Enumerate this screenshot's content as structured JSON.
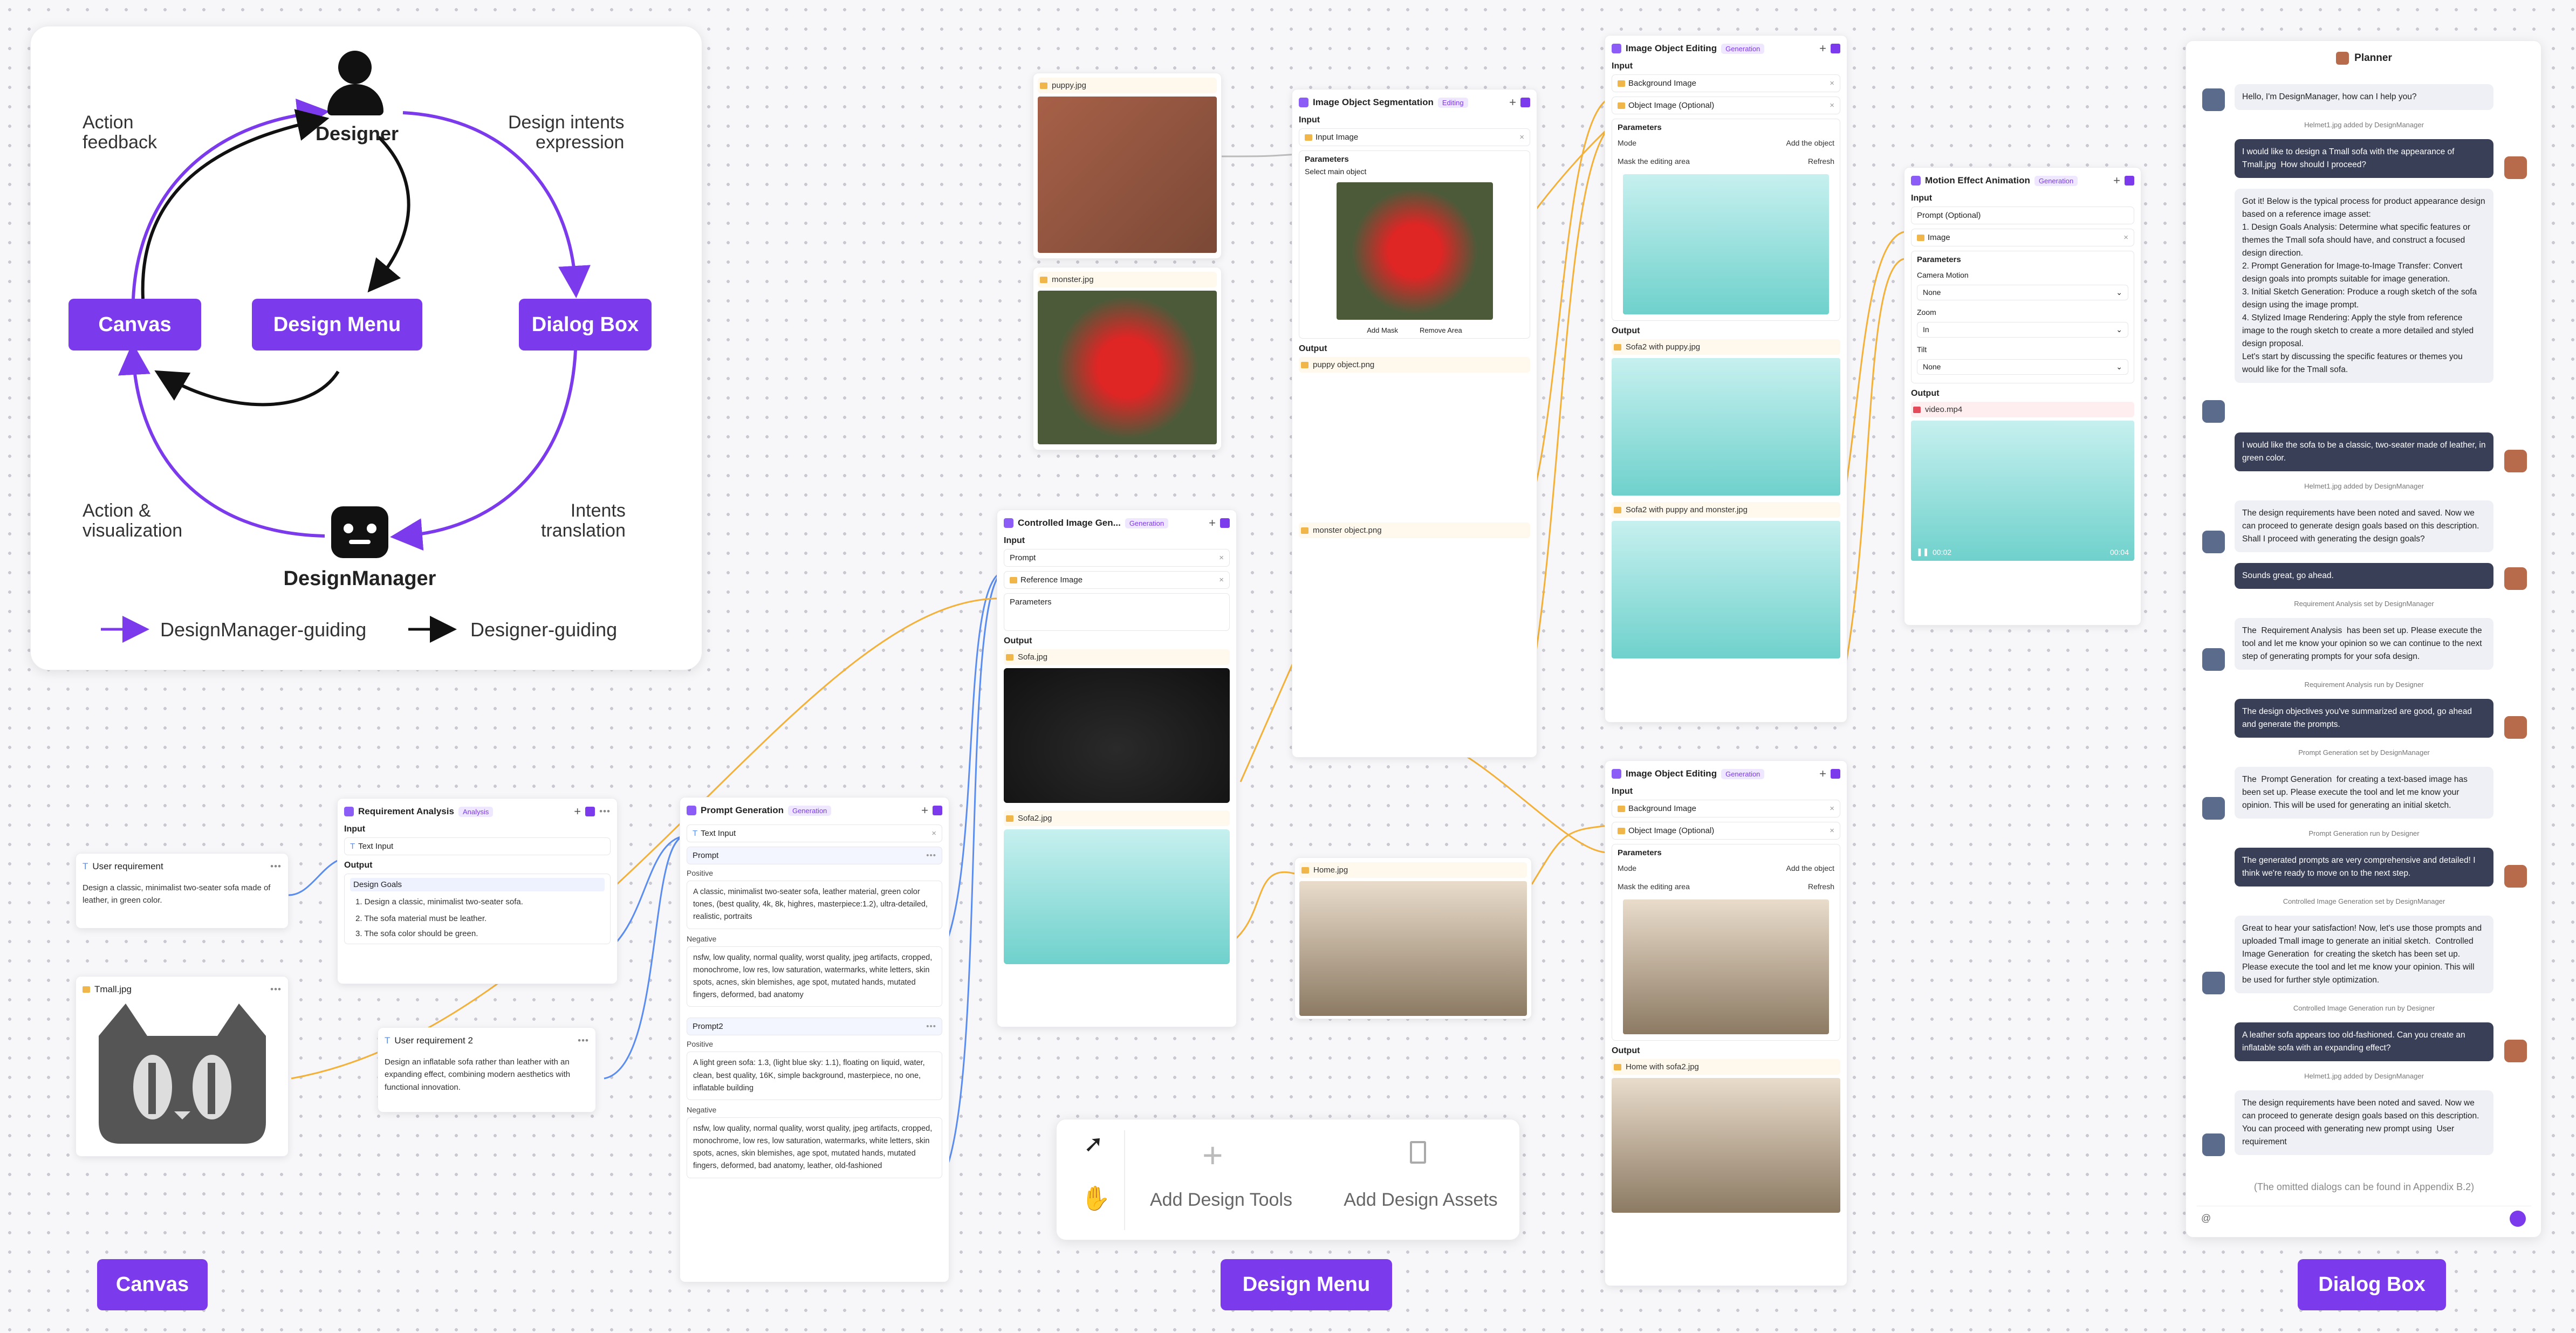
{
  "overview": {
    "designer": "Designer",
    "design_manager": "DesignManager",
    "canvas": "Canvas",
    "design_menu": "Design Menu",
    "dialog_box": "Dialog Box",
    "action_feedback": "Action\nfeedback",
    "design_intents": "Design intents\nexpression",
    "action_vis": "Action &\nvisualization",
    "intents_translation": "Intents\ntranslation",
    "legend_purple": "DesignManager-guiding",
    "legend_black": "Designer-guiding",
    "colors": {
      "purple": "#7c3aed",
      "black": "#111111"
    }
  },
  "bottom_labels": {
    "canvas": "Canvas",
    "design_menu": "Design Menu",
    "dialog_box": "Dialog Box"
  },
  "canvas": {
    "user_req": {
      "title": "User requirement",
      "text": "Design a classic, minimalist two-seater sofa made of leather, in green color."
    },
    "tmall": {
      "title": "Tmall.jpg"
    },
    "user_req2": {
      "title": "User requirement 2",
      "text": "Design an inflatable sofa rather than leather with an expanding effect, combining modern aesthetics with functional innovation."
    },
    "req_analysis": {
      "title": "Requirement Analysis",
      "tag": "Analysis",
      "input": "Input",
      "text_input": "Text Input",
      "output": "Output",
      "design_goals": "Design Goals",
      "goals": [
        "1. Design a classic, minimalist two-seater sofa.",
        "2. The sofa material must be leather.",
        "3. The sofa color should be green."
      ]
    },
    "prompt_gen": {
      "title": "Prompt Generation",
      "tag": "Generation",
      "text_input": "Text Input",
      "prompt": "Prompt",
      "positive": "Positive",
      "pos_text": "A classic, minimalist two-seater sofa, leather material, green color tones, (best quality, 4k, 8k, highres, masterpiece:1.2), ultra-detailed, realistic, portraits",
      "negative": "Negative",
      "neg_text": "nsfw, low quality, normal quality, worst quality, jpeg artifacts, cropped, monochrome, low res, low saturation, watermarks, white letters, skin spots, acnes, skin blemishes, age spot, mutated hands, mutated fingers, deformed, bad anatomy",
      "prompt2": "Prompt2",
      "pos2_text": "A light green sofa: 1.3, (light blue sky: 1.1), floating on liquid, water, clean, best quality, 16K, simple background, masterpiece, no one, inflatable building",
      "neg2_text": "nsfw, low quality, normal quality, worst quality, jpeg artifacts, cropped, monochrome, low res, low saturation, watermarks, white letters, skin spots, acnes, skin blemishes, age spot, mutated hands, mutated fingers, deformed, bad anatomy, leather, old-fashioned"
    },
    "controlled": {
      "title": "Controlled Image Gen...",
      "tag": "Generation",
      "input": "Input",
      "prompt": "Prompt",
      "ref": "Reference Image",
      "params": "Parameters",
      "output": "Output",
      "sofa": "Sofa.jpg",
      "sofa2": "Sofa2.jpg"
    },
    "puppy": "puppy.jpg",
    "monster": "monster.jpg",
    "home": "Home.jpg",
    "segmentation": {
      "title": "Image Object Segmentation",
      "tag": "Editing",
      "input": "Input",
      "input_image": "Input Image",
      "params": "Parameters",
      "select": "Select main object",
      "add_mask": "Add Mask",
      "remove_area": "Remove Area",
      "output": "Output",
      "puppy_obj": "puppy object.png",
      "monster_obj": "monster object.png"
    },
    "editing1": {
      "title": "Image Object Editing",
      "tag": "Generation",
      "input": "Input",
      "bg": "Background Image",
      "obj": "Object Image (Optional)",
      "params": "Parameters",
      "mode": "Mode",
      "mode_val": "Add the object",
      "mask": "Mask the editing area",
      "refresh": "Refresh",
      "output": "Output",
      "out1": "Sofa2 with puppy.jpg",
      "out2": "Sofa2 with puppy and monster.jpg"
    },
    "editing2": {
      "title": "Image Object Editing",
      "tag": "Generation",
      "input": "Input",
      "bg": "Background Image",
      "obj": "Object Image (Optional)",
      "params": "Parameters",
      "mode": "Mode",
      "mode_val": "Add the object",
      "mask": "Mask the editing area",
      "refresh": "Refresh",
      "output": "Output",
      "out1": "Home with sofa2.jpg"
    },
    "motion": {
      "title": "Motion Effect Animation",
      "tag": "Generation",
      "input": "Input",
      "prompt": "Prompt (Optional)",
      "image": "Image",
      "params": "Parameters",
      "cam": "Camera Motion",
      "cam_val": "None",
      "zoom": "Zoom",
      "zoom_val": "In",
      "tilt": "Tilt",
      "tilt_val": "None",
      "output": "Output",
      "video": "video.mp4",
      "t0": "00:02",
      "t1": "00:04"
    }
  },
  "menu": {
    "add_tools": "Add Design Tools",
    "add_assets": "Add Design Assets"
  },
  "dialog": {
    "title": "Planner",
    "msgs": [
      {
        "who": "bot",
        "text": "Hello, I'm DesignManager, how can I help you?"
      },
      {
        "who": "sys",
        "text": "Helmet1.jpg  added by DesignManager"
      },
      {
        "who": "usr",
        "text": "I would like to design a Tmall sofa with the appearance of  Tmall.jpg  How should I proceed?"
      },
      {
        "who": "bot",
        "text": "Got it! Below is the typical process for product appearance design based on a reference image asset:\n1. Design Goals Analysis: Determine what specific features or themes the Tmall sofa should have, and construct a focused design direction.\n2. Prompt Generation for Image-to-Image Transfer: Convert design goals into prompts suitable for image generation.\n3. Initial Sketch Generation: Produce a rough sketch of the sofa design using the image prompt.\n4. Stylized Image Rendering: Apply the style from reference image to the rough sketch to create a more detailed and styled design proposal.\nLet's start by discussing the specific features or themes you would like for the Tmall sofa."
      },
      {
        "who": "usr",
        "text": "I would like the sofa to be a classic, two-seater made of leather, in green color."
      },
      {
        "who": "sys",
        "text": "Helmet1.jpg  added by DesignManager"
      },
      {
        "who": "bot",
        "text": "The design requirements have been noted and saved. Now we can proceed to generate design goals based on this description. Shall I proceed with generating the design goals?"
      },
      {
        "who": "usr",
        "text": "Sounds great, go ahead."
      },
      {
        "who": "sys",
        "text": "Requirement Analysis  set by DesignManager"
      },
      {
        "who": "bot",
        "text": "The  Requirement Analysis  has been set up. Please execute the tool and let me know your opinion so we can continue to the next step of generating prompts for your sofa design."
      },
      {
        "who": "sys",
        "text": "Requirement Analysis  run by Designer"
      },
      {
        "who": "usr",
        "text": "The design objectives you've summarized are good, go ahead and generate the prompts."
      },
      {
        "who": "sys",
        "text": "Prompt Generation  set by DesignManager"
      },
      {
        "who": "bot",
        "text": "The  Prompt Generation  for creating a text-based image has been set up. Please execute the tool and let me know your opinion. This will be used for generating an initial sketch."
      },
      {
        "who": "sys",
        "text": "Prompt Generation  run by Designer"
      },
      {
        "who": "usr",
        "text": "The generated prompts are very comprehensive and detailed! I think we're ready to move on to the next step."
      },
      {
        "who": "sys",
        "text": "Controlled Image Generation  set by DesignManager"
      },
      {
        "who": "bot",
        "text": "Great to hear your satisfaction! Now, let's use those prompts and uploaded Tmall image to generate an initial sketch.  Controlled Image Generation  for creating the sketch has been set up. Please execute the tool and let me know your opinion. This will be used for further style optimization."
      },
      {
        "who": "sys",
        "text": "Controlled Image Generation  run by Designer"
      },
      {
        "who": "usr",
        "text": "A leather sofa appears too old-fashioned. Can you create an inflatable sofa with an expanding effect?"
      },
      {
        "who": "sys",
        "text": "Helmet1.jpg  added by DesignManager"
      },
      {
        "who": "bot",
        "text": "The design requirements have been noted and saved. Now we can proceed to generate design goals based on this description. You can proceed with generating new prompt using  User requirement"
      }
    ],
    "omitted": "(The omitted dialogs can be found in Appendix B.2)",
    "input_icon": "@"
  }
}
